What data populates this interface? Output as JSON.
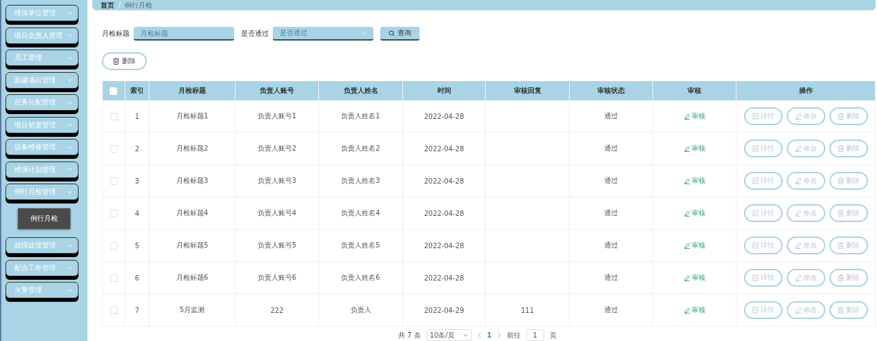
{
  "sidebar": {
    "items": [
      {
        "label": "维保单位管理"
      },
      {
        "label": "项目负责人管理"
      },
      {
        "label": "员工管理"
      },
      {
        "label": "新建项目管理"
      },
      {
        "label": "任务分配管理"
      },
      {
        "label": "项目初查管理"
      },
      {
        "label": "设备维修管理"
      },
      {
        "label": "维保计划管理"
      },
      {
        "label": "例行月检管理",
        "children": [
          {
            "label": "例行月检",
            "selected": true
          }
        ]
      },
      {
        "label": "故障处理管理"
      },
      {
        "label": "配合工作管理"
      },
      {
        "label": "火警管理"
      }
    ]
  },
  "breadcrumb": {
    "items": [
      "首页",
      "例行月检"
    ],
    "separator": "/"
  },
  "search": {
    "fields": [
      {
        "label": "月检标题",
        "kind": "input",
        "placeholder": "月检标题"
      },
      {
        "label": "是否通过",
        "kind": "select",
        "placeholder": "是否通过"
      }
    ],
    "button": "查询"
  },
  "toolbar": {
    "delete_button": "删除"
  },
  "table": {
    "select_all": {
      "checked": false
    },
    "columns": [
      "索引",
      "月检标题",
      "负责人账号",
      "负责人姓名",
      "时间",
      "审核回复",
      "审核状态",
      "审核",
      "操作"
    ],
    "rows": [
      {
        "checked": false,
        "cells": [
          "1",
          "月检标题1",
          "负责人账号1",
          "负责人姓名1",
          "2022-04-28",
          "",
          "通过"
        ],
        "review": "审核",
        "actions": [
          "详情",
          "修改",
          "删除"
        ]
      },
      {
        "checked": false,
        "cells": [
          "2",
          "月检标题2",
          "负责人账号2",
          "负责人姓名2",
          "2022-04-28",
          "",
          "通过"
        ],
        "review": "审核",
        "actions": [
          "详情",
          "修改",
          "删除"
        ]
      },
      {
        "checked": false,
        "cells": [
          "3",
          "月检标题3",
          "负责人账号3",
          "负责人姓名3",
          "2022-04-28",
          "",
          "通过"
        ],
        "review": "审核",
        "actions": [
          "详情",
          "修改",
          "删除"
        ]
      },
      {
        "checked": false,
        "cells": [
          "4",
          "月检标题4",
          "负责人账号4",
          "负责人姓名4",
          "2022-04-28",
          "",
          "通过"
        ],
        "review": "审核",
        "actions": [
          "详情",
          "修改",
          "删除"
        ]
      },
      {
        "checked": false,
        "cells": [
          "5",
          "月检标题5",
          "负责人账号5",
          "负责人姓名5",
          "2022-04-28",
          "",
          "通过"
        ],
        "review": "审核",
        "actions": [
          "详情",
          "修改",
          "删除"
        ]
      },
      {
        "checked": false,
        "cells": [
          "6",
          "月检标题6",
          "负责人账号6",
          "负责人姓名6",
          "2022-04-28",
          "",
          "通过"
        ],
        "review": "审核",
        "actions": [
          "详情",
          "修改",
          "删除"
        ]
      },
      {
        "checked": false,
        "cells": [
          "7",
          "5月监测",
          "222",
          "负责人",
          "2022-04-29",
          "111",
          "通过"
        ],
        "review": "审核",
        "actions": [
          "详情",
          "修改",
          "删除"
        ]
      }
    ]
  },
  "pagination": {
    "total": "共 7 条",
    "page_size": "10条/页",
    "pages": [
      {
        "label": "1",
        "selected": true
      }
    ],
    "goto_label": "前往",
    "goto_value": "1",
    "goto_suffix": "页"
  }
}
